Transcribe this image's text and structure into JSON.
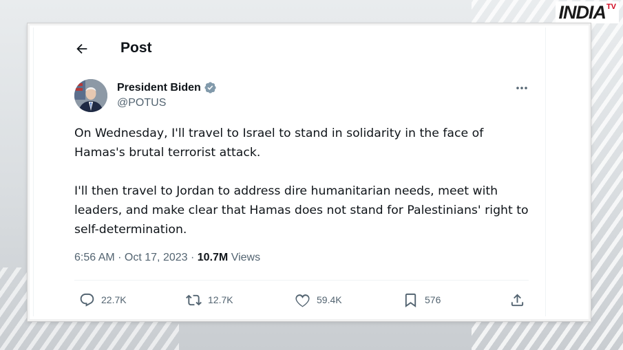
{
  "watermark": {
    "brand": "INDIA",
    "suffix": "TV"
  },
  "header": {
    "title": "Post",
    "back_icon": "arrow-left-icon"
  },
  "author": {
    "name": "President Biden",
    "handle": "@POTUS",
    "verified_color": "#829aab"
  },
  "tweet": {
    "paragraphs": [
      "On Wednesday, I'll travel to Israel to stand in solidarity in the face of Hamas's brutal terrorist attack.",
      "I'll then travel to Jordan to address dire humanitarian needs, meet with leaders, and make clear that Hamas does not stand for Palestinians' right to self-determination."
    ],
    "time": "6:56 AM",
    "separator": " · ",
    "date": "Oct 17, 2023",
    "views_count": "10.7M",
    "views_label": "Views"
  },
  "actions": {
    "reply": "22.7K",
    "repost": "12.7K",
    "like": "59.4K",
    "bookmark": "576"
  },
  "colors": {
    "text": "#0f1419",
    "muted": "#536471",
    "logo_accent": "#d0021b"
  }
}
